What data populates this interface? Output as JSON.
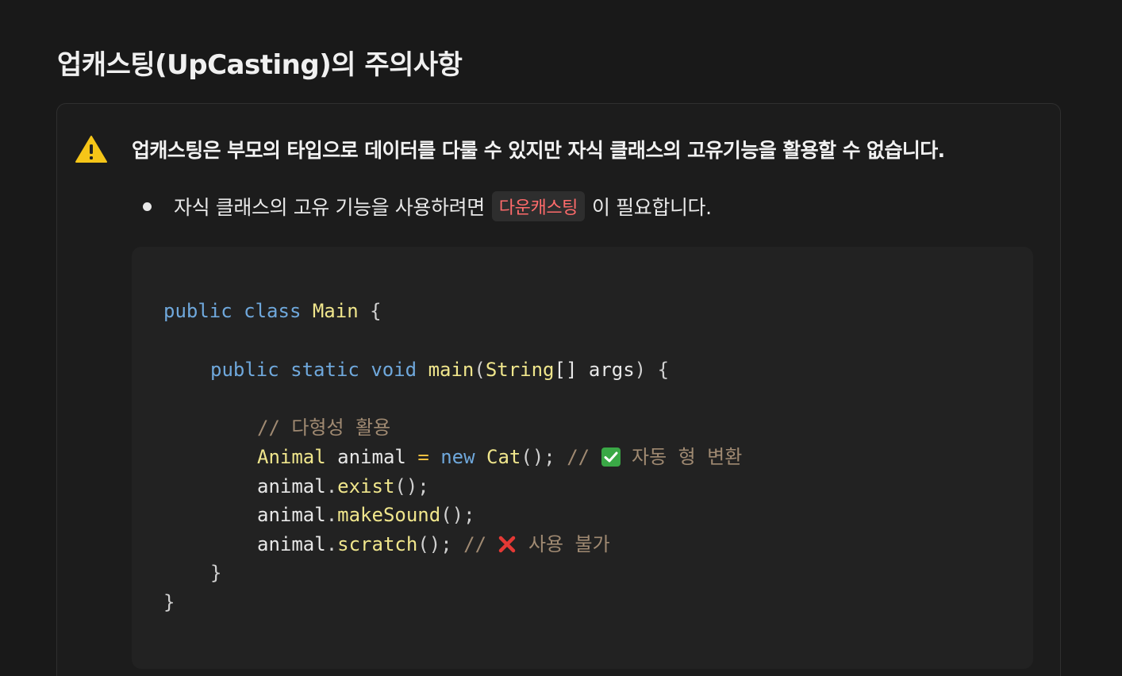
{
  "heading": "업캐스팅(UpCasting)의 주의사항",
  "callout": {
    "icon": "warning-icon",
    "text": "업캐스팅은 부모의 타입으로 데이터를 다룰 수 있지만 자식 클래스의 고유기능을 활용할 수 없습니다.",
    "bullet": {
      "before": "자식 클래스의 고유 기능을 사용하려면",
      "code": "다운캐스팅",
      "after": "이 필요합니다."
    }
  },
  "code": {
    "l1": {
      "kw1": "public",
      "kw2": "class",
      "name": "Main",
      "brace": "{"
    },
    "l2": {
      "kw1": "public",
      "kw2": "static",
      "kw3": "void",
      "fn": "main",
      "p1": "(",
      "type": "String",
      "rest": "[] args",
      "p2": ")",
      "brace": "{"
    },
    "l3": {
      "comment": "// 다형성 활용"
    },
    "l4": {
      "type": "Animal",
      "var": "animal",
      "eq": "=",
      "kw": "new",
      "cls": "Cat",
      "paren": "();",
      "comment_start": "//",
      "comment_text": "자동 형 변환"
    },
    "l5": {
      "obj": "animal",
      "dot": ".",
      "fn": "exist",
      "paren": "();"
    },
    "l6": {
      "obj": "animal",
      "dot": ".",
      "fn": "makeSound",
      "paren": "();"
    },
    "l7": {
      "obj": "animal",
      "dot": ".",
      "fn": "scratch",
      "paren": "();",
      "comment_start": "//",
      "comment_text": "사용 불가"
    },
    "l8": {
      "brace": "}"
    },
    "l9": {
      "brace": "}"
    }
  },
  "colors": {
    "background": "#191919",
    "keyword": "#6fa8dc",
    "type": "#f0e68c",
    "comment": "#a08a72",
    "inline_code": "#ff6b6b"
  }
}
